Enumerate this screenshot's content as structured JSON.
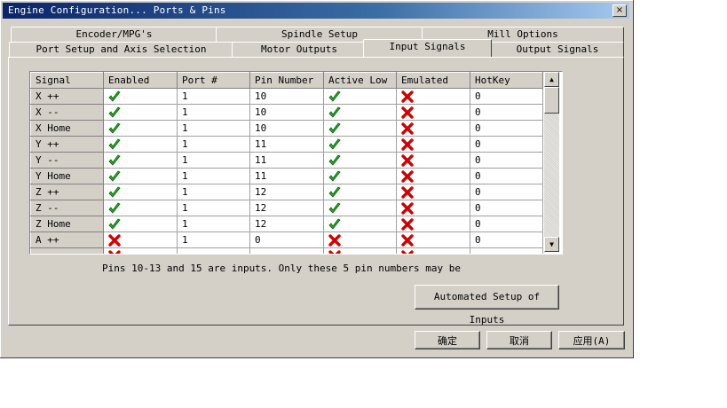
{
  "window": {
    "title": "Engine Configuration... Ports & Pins",
    "close_symbol": "×"
  },
  "tabs": {
    "row1": [
      {
        "label": "Encoder/MPG's"
      },
      {
        "label": "Spindle Setup"
      },
      {
        "label": "Mill Options"
      }
    ],
    "row2": [
      {
        "label": "Port Setup and Axis Selection"
      },
      {
        "label": "Motor Outputs"
      },
      {
        "label": "Input Signals",
        "active": true
      },
      {
        "label": "Output Signals"
      }
    ]
  },
  "grid": {
    "columns": [
      "Signal",
      "Enabled",
      "Port #",
      "Pin Number",
      "Active Low",
      "Emulated",
      "HotKey"
    ],
    "rows": [
      {
        "signal": "X ++",
        "enabled": true,
        "port": "1",
        "pin": "10",
        "active_low": true,
        "emulated": false,
        "hotkey": "0"
      },
      {
        "signal": "X --",
        "enabled": true,
        "port": "1",
        "pin": "10",
        "active_low": true,
        "emulated": false,
        "hotkey": "0"
      },
      {
        "signal": "X Home",
        "enabled": true,
        "port": "1",
        "pin": "10",
        "active_low": true,
        "emulated": false,
        "hotkey": "0"
      },
      {
        "signal": "Y ++",
        "enabled": true,
        "port": "1",
        "pin": "11",
        "active_low": true,
        "emulated": false,
        "hotkey": "0"
      },
      {
        "signal": "Y --",
        "enabled": true,
        "port": "1",
        "pin": "11",
        "active_low": true,
        "emulated": false,
        "hotkey": "0"
      },
      {
        "signal": "Y Home",
        "enabled": true,
        "port": "1",
        "pin": "11",
        "active_low": true,
        "emulated": false,
        "hotkey": "0"
      },
      {
        "signal": "Z ++",
        "enabled": true,
        "port": "1",
        "pin": "12",
        "active_low": true,
        "emulated": false,
        "hotkey": "0"
      },
      {
        "signal": "Z --",
        "enabled": true,
        "port": "1",
        "pin": "12",
        "active_low": true,
        "emulated": false,
        "hotkey": "0"
      },
      {
        "signal": "Z Home",
        "enabled": true,
        "port": "1",
        "pin": "12",
        "active_low": true,
        "emulated": false,
        "hotkey": "0"
      },
      {
        "signal": "A ++",
        "enabled": false,
        "port": "1",
        "pin": "0",
        "active_low": false,
        "emulated": false,
        "hotkey": "0"
      },
      {
        "signal": "",
        "enabled": false,
        "port": "",
        "pin": "",
        "active_low": false,
        "emulated": false,
        "hotkey": ""
      }
    ]
  },
  "icons": {
    "check": "green-check-icon",
    "cross": "red-x-icon",
    "check_color": "#22b422",
    "cross_color": "#d40000"
  },
  "note": "Pins 10-13 and 15 are inputs. Only these 5 pin numbers may be",
  "buttons": {
    "auto_setup": "Automated Setup of Inputs",
    "ok": "确定",
    "cancel": "取消",
    "apply": "应用(A)"
  },
  "colors": {
    "title_bar": "#0a246a",
    "face": "#d4d0c8"
  }
}
